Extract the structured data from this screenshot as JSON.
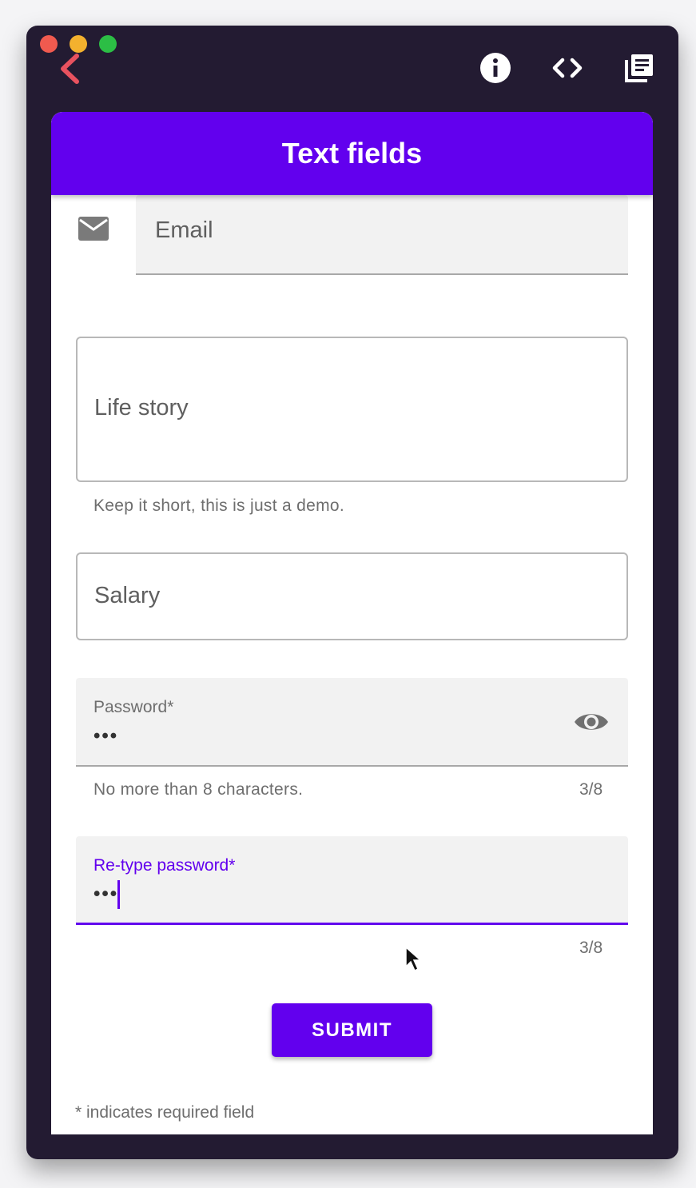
{
  "appbar": {
    "title": "Text fields"
  },
  "email": {
    "label": "Email"
  },
  "life_story": {
    "label": "Life story",
    "helper": "Keep it short, this is just a demo."
  },
  "salary": {
    "label": "Salary"
  },
  "password": {
    "label": "Password*",
    "value": "•••",
    "helper": "No more than 8 characters.",
    "counter": "3/8"
  },
  "retype_password": {
    "label": "Re-type password*",
    "value": "•••",
    "counter": "3/8"
  },
  "submit": {
    "label": "SUBMIT"
  },
  "footer": {
    "required_note": "* indicates required field"
  },
  "colors": {
    "primary": "#6200ee",
    "window_bg": "#231b32",
    "back_arrow": "#e8525f"
  },
  "icons": [
    "back-arrow-icon",
    "info-icon",
    "code-icon",
    "library-icon",
    "email-icon",
    "visibility-icon",
    "mouse-pointer-icon"
  ]
}
